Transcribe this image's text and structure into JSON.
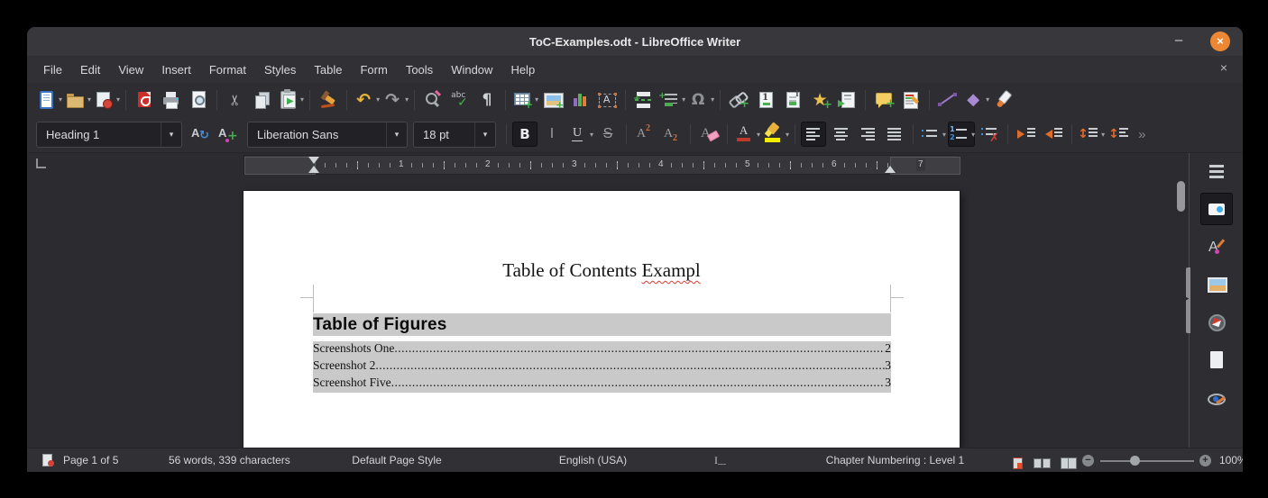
{
  "window": {
    "title": "ToC-Examples.odt - LibreOffice Writer",
    "controls": {
      "minimize": "–",
      "close": "×"
    }
  },
  "menubar": {
    "items": [
      "File",
      "Edit",
      "View",
      "Insert",
      "Format",
      "Styles",
      "Table",
      "Form",
      "Tools",
      "Window",
      "Help"
    ],
    "close": "×"
  },
  "toolbar": {
    "groups": [
      [
        {
          "icon": "new-document",
          "dropdown": true
        },
        {
          "icon": "open-folder",
          "dropdown": true
        },
        {
          "icon": "save",
          "dropdown": true
        }
      ],
      [
        {
          "icon": "export-pdf"
        },
        {
          "icon": "print"
        },
        {
          "icon": "print-preview"
        }
      ],
      [
        {
          "icon": "cut"
        },
        {
          "icon": "copy"
        },
        {
          "icon": "paste",
          "dropdown": true
        }
      ],
      [
        {
          "icon": "clone-formatting"
        }
      ],
      [
        {
          "icon": "undo",
          "dropdown": true
        },
        {
          "icon": "redo",
          "dropdown": true
        }
      ],
      [
        {
          "icon": "find-and-replace"
        },
        {
          "icon": "spelling"
        },
        {
          "icon": "formatting-marks"
        }
      ],
      [
        {
          "icon": "insert-table",
          "dropdown": true
        },
        {
          "icon": "insert-image"
        },
        {
          "icon": "insert-chart"
        },
        {
          "icon": "insert-textbox"
        }
      ],
      [
        {
          "icon": "insert-page-break"
        },
        {
          "icon": "insert-field",
          "dropdown": true
        },
        {
          "icon": "insert-special-character",
          "dropdown": true
        }
      ],
      [
        {
          "icon": "insert-hyperlink"
        },
        {
          "icon": "insert-footnote"
        },
        {
          "icon": "insert-endnote"
        },
        {
          "icon": "insert-bookmark"
        },
        {
          "icon": "insert-cross-reference"
        }
      ],
      [
        {
          "icon": "insert-comment"
        },
        {
          "icon": "track-changes"
        }
      ],
      [
        {
          "icon": "insert-line"
        },
        {
          "icon": "basic-shapes",
          "dropdown": true
        },
        {
          "icon": "show-draw-functions"
        }
      ]
    ]
  },
  "formatting": {
    "paragraph_style": "Heading 1",
    "font_name": "Liberation Sans",
    "font_size": "18 pt",
    "style_actions": [
      {
        "icon": "update-style"
      },
      {
        "icon": "new-style"
      }
    ],
    "groups": [
      [
        {
          "icon": "bold",
          "active": true
        },
        {
          "icon": "italic"
        },
        {
          "icon": "underline",
          "dropdown": true
        },
        {
          "icon": "strikethrough"
        }
      ],
      [
        {
          "icon": "superscript"
        },
        {
          "icon": "subscript"
        }
      ],
      [
        {
          "icon": "clear-formatting"
        }
      ],
      [
        {
          "icon": "font-color",
          "dropdown": true
        },
        {
          "icon": "highlight-color",
          "dropdown": true
        }
      ],
      [
        {
          "icon": "align-left",
          "active": true
        },
        {
          "icon": "align-center"
        },
        {
          "icon": "align-right"
        },
        {
          "icon": "align-justify"
        }
      ],
      [
        {
          "icon": "bullet-list",
          "dropdown": true
        },
        {
          "icon": "numbered-list",
          "active": true,
          "dropdown": true
        },
        {
          "icon": "no-list"
        }
      ],
      [
        {
          "icon": "increase-indent"
        },
        {
          "icon": "decrease-indent"
        }
      ],
      [
        {
          "icon": "line-spacing",
          "dropdown": true
        },
        {
          "icon": "paragraph-spacing"
        }
      ]
    ],
    "overflow": "»"
  },
  "ruler": {
    "numbers": [
      "1",
      "2",
      "3",
      "4",
      "5",
      "6",
      "7"
    ]
  },
  "document": {
    "title": {
      "text_before": "Table of Contents ",
      "misspelled": "Exampl"
    },
    "table_of_figures": {
      "heading": "Table of Figures",
      "entries": [
        {
          "label": "Screenshots One",
          "page": "2"
        },
        {
          "label": "Screenshot 2",
          "page": "3"
        },
        {
          "label": "Screenshot Five",
          "page": "3"
        }
      ]
    }
  },
  "sidebar": {
    "items": [
      {
        "icon": "sidebar-settings"
      },
      {
        "icon": "properties",
        "active": true
      },
      {
        "icon": "styles"
      },
      {
        "icon": "gallery"
      },
      {
        "icon": "navigator"
      },
      {
        "icon": "page-deck"
      },
      {
        "icon": "accessibility-check"
      }
    ]
  },
  "statusbar": {
    "page_info": "Page 1 of 5",
    "word_count": "56 words, 339 characters",
    "page_style": "Default Page Style",
    "language": "English (USA)",
    "outline": "Chapter Numbering : Level 1",
    "zoom_level": "100%"
  },
  "colors": {
    "close_button": "#ee8733",
    "toc_field_shading": "#c9c9c9",
    "font_color_swatch": "#c0392b",
    "highlight_swatch": "#f4ed00"
  }
}
